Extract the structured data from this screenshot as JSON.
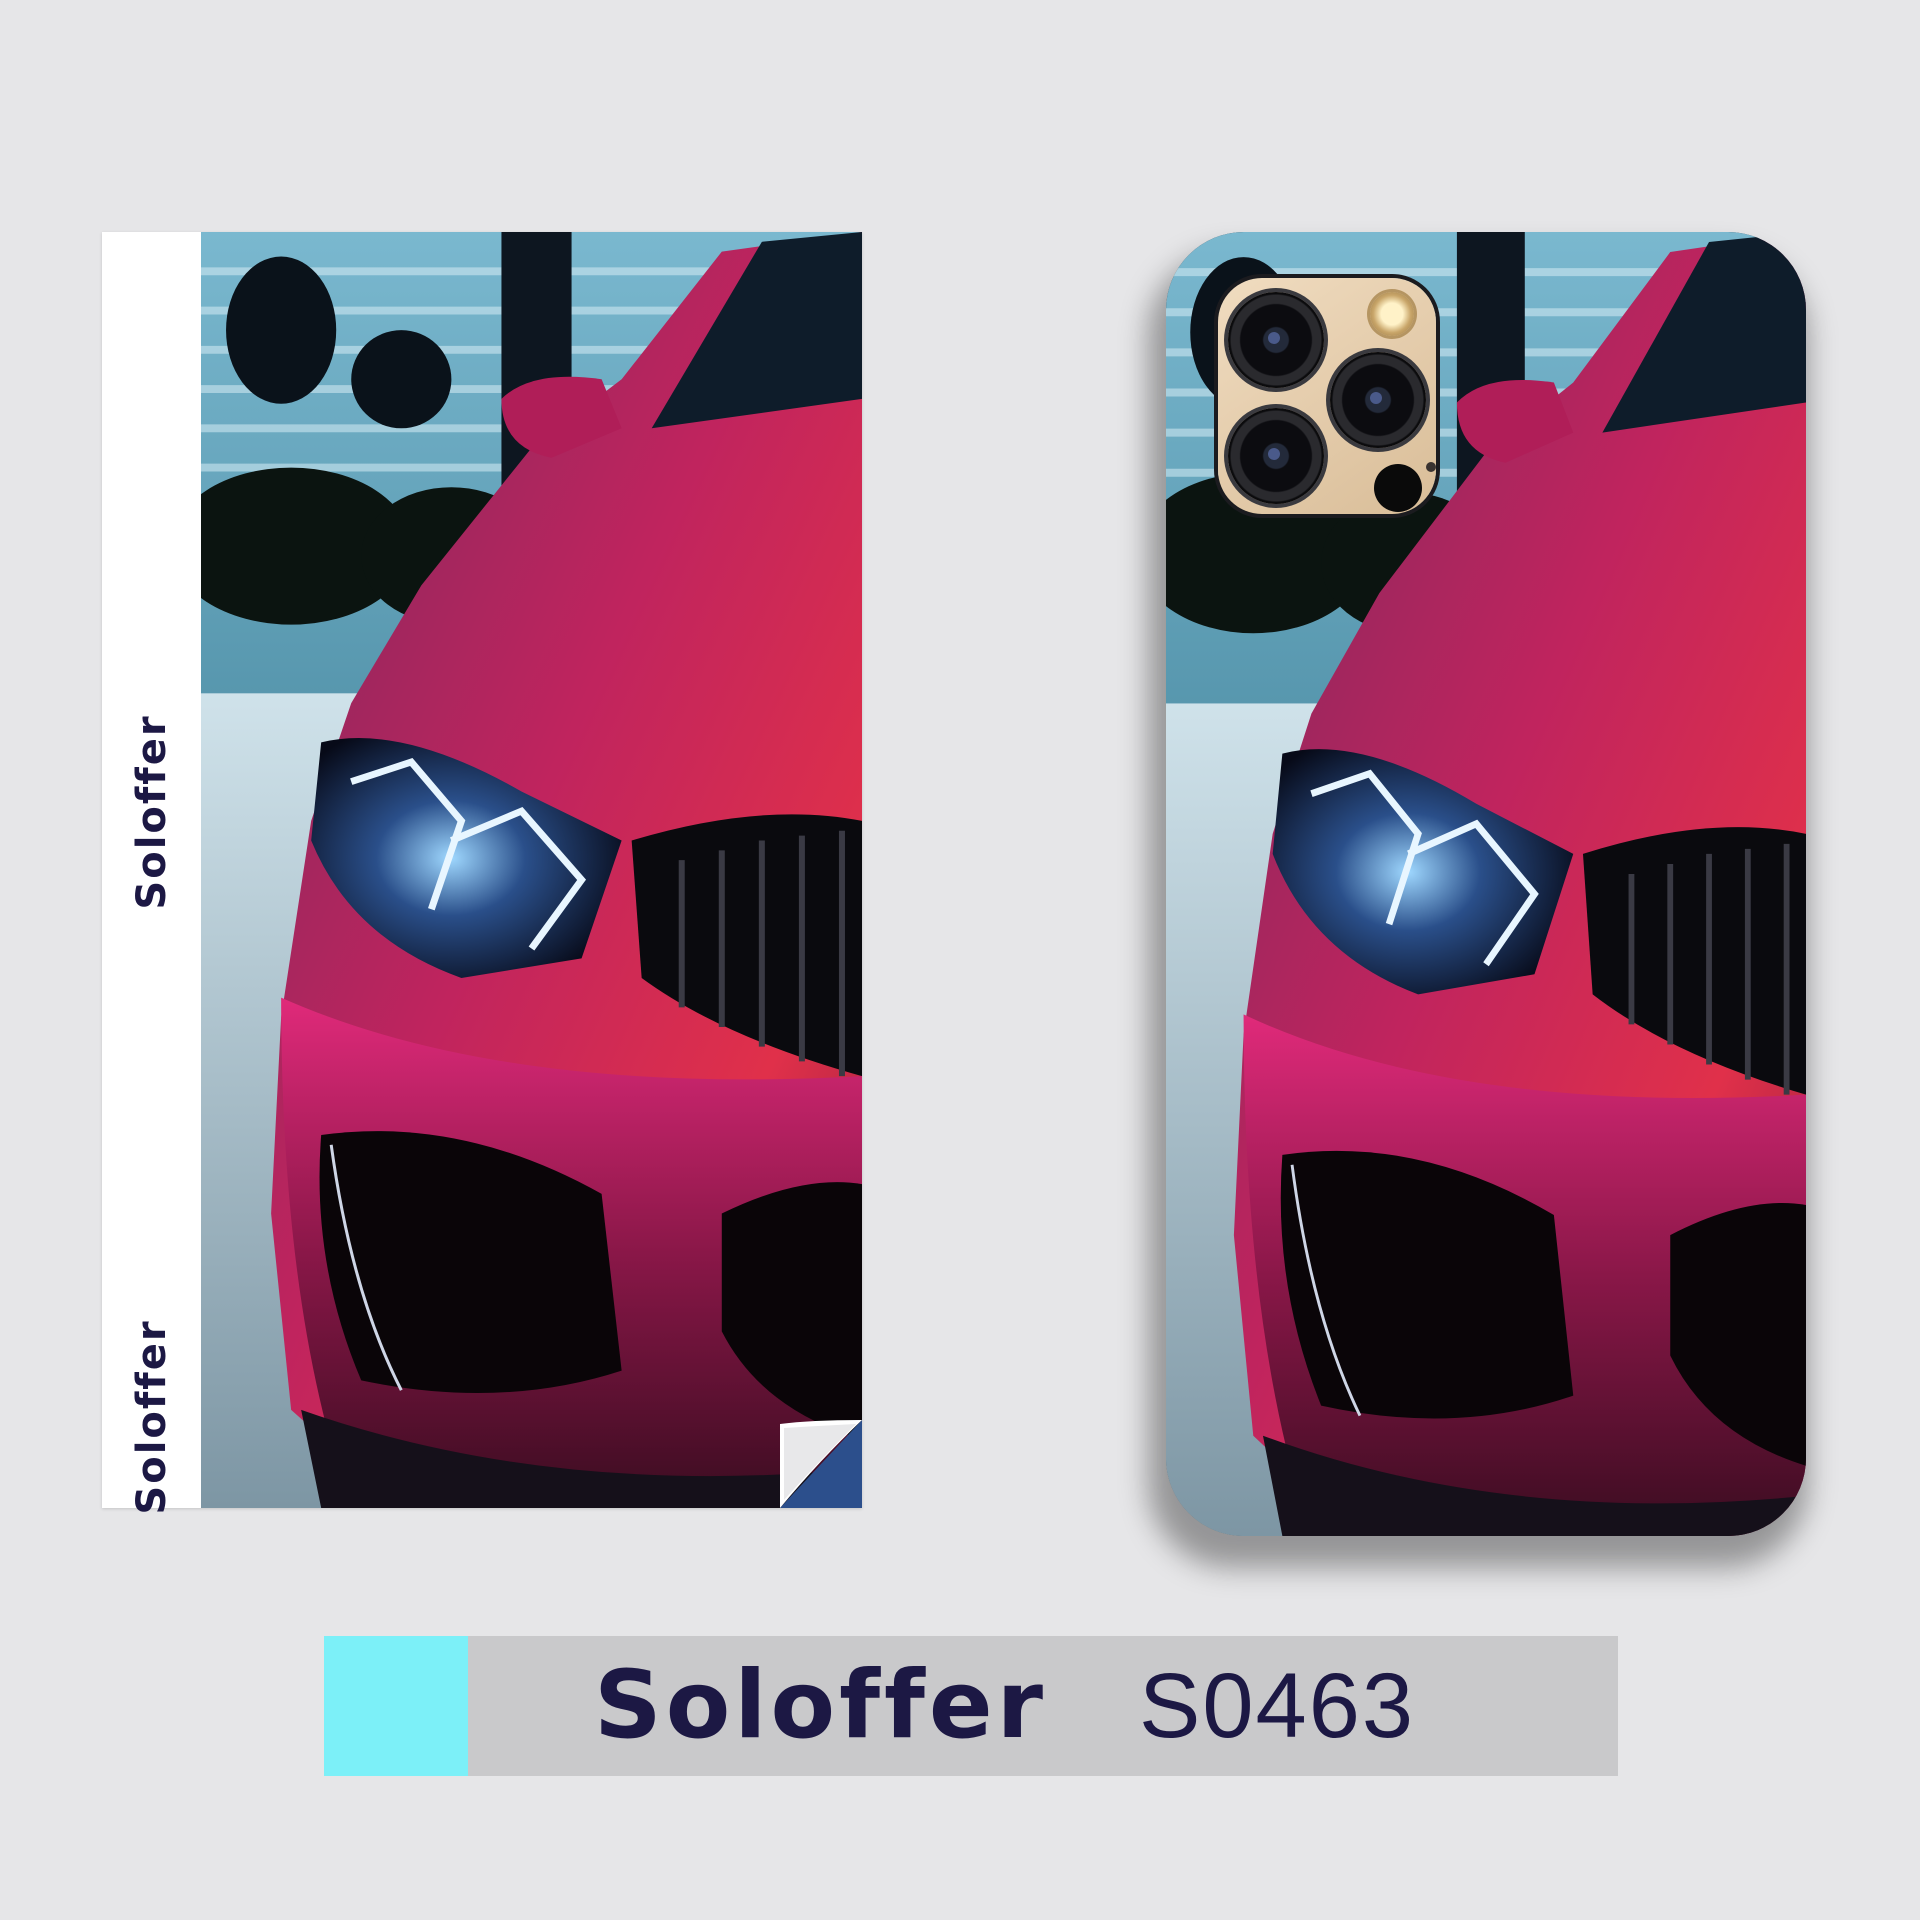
{
  "sticker_sheet": {
    "brand_labels": [
      "Soloffer",
      "Soloffer"
    ]
  },
  "product_label": {
    "brand": "Soloffer",
    "code": "S0463",
    "accent_color": "#7cf0f8",
    "text_color": "#1c1844"
  },
  "artwork": {
    "subject": "magenta sports car front headlight",
    "primary_color": "#c0245e"
  }
}
